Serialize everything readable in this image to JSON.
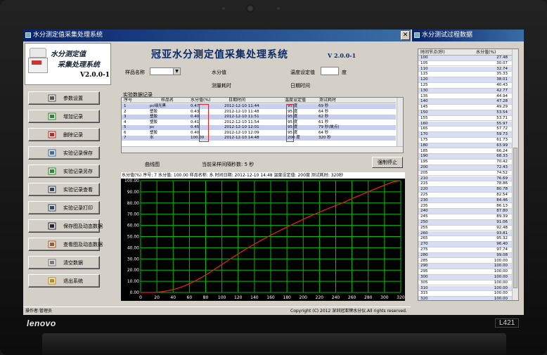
{
  "laptop": {
    "brand": "lenovo",
    "model": "L421"
  },
  "main_window": {
    "title": "水分测定值采集处理系统",
    "close_glyph": "✕"
  },
  "logo": {
    "line1": "水分测定值",
    "line2": "采集处理系统",
    "version": "V2.0.0-1"
  },
  "app": {
    "title": "冠亚水分测定值采集处理系统",
    "version": "V 2.0.0-1"
  },
  "sidebar": {
    "buttons": [
      {
        "label": "参数设置",
        "icon": "wrench-icon"
      },
      {
        "label": "增加记录",
        "icon": "add-record-icon"
      },
      {
        "label": "删除记录",
        "icon": "delete-record-icon"
      },
      {
        "label": "实验记录保存",
        "icon": "save-truck-icon"
      },
      {
        "label": "实验记录另存",
        "icon": "save-as-icon"
      },
      {
        "label": "实验记录查看",
        "icon": "magnifier-icon"
      },
      {
        "label": "实验记录打印",
        "icon": "printer-icon"
      },
      {
        "label": "保存图及动态数据",
        "icon": "floppy-icon"
      },
      {
        "label": "查看图及动态数据",
        "icon": "chart-view-icon"
      },
      {
        "label": "清空数据",
        "icon": "clear-data-icon"
      },
      {
        "label": "退出系统",
        "icon": "exit-icon"
      }
    ]
  },
  "form": {
    "sample_name_label": "样品名称",
    "sample_name_value": "",
    "moisture_label": "水分值",
    "temp_setting_label": "温度设定值",
    "temp_unit": "度",
    "measure_time_label": "测量耗时",
    "date_label": "日期时间"
  },
  "records": {
    "section_label": "实验数据记录",
    "columns": [
      "序号",
      "样品名",
      "水分值(%)",
      "日期时间",
      "温度设定值",
      "测试耗时"
    ],
    "rows": [
      {
        "no": "1",
        "name": "pc绿光黑",
        "moisture": "0.47",
        "datetime": "2012-12-10  11:44",
        "temp": "95 度",
        "time": "69 秒",
        "highlight": true
      },
      {
        "no": "2",
        "name": "塑胶",
        "moisture": "0.43",
        "datetime": "2012-12-10  11:48",
        "temp": "95 度",
        "time": "64 秒",
        "highlight": false
      },
      {
        "no": "3",
        "name": "塑胶",
        "moisture": "0.40",
        "datetime": "2012-12-10  11:51",
        "temp": "95 度",
        "time": "62 秒",
        "highlight": true
      },
      {
        "no": "4",
        "name": "塑胶",
        "moisture": "0.41",
        "datetime": "2012-12-10  11:54",
        "temp": "95 度",
        "time": "61 秒",
        "highlight": false
      },
      {
        "no": "5",
        "name": "pc",
        "moisture": "0.45",
        "datetime": "2012-12-10  12:01",
        "temp": "95 度",
        "time": "79 秒(故点)",
        "highlight": true
      },
      {
        "no": "6",
        "name": "塑胶",
        "moisture": "0.40",
        "datetime": "2012-12-10  12:09",
        "temp": "95 度",
        "time": "64 秒",
        "highlight": false
      },
      {
        "no": "7",
        "name": "水",
        "moisture": "100.00",
        "datetime": "2012-12-10  14:48",
        "temp": "200 度",
        "time": "320 秒",
        "highlight": true
      }
    ]
  },
  "chart_panel": {
    "curve_label": "曲线图",
    "interval_label": "当前采样间隔秒数: 5 秒",
    "stop_button": "强制停止",
    "header": "水分值(%) 序号: 7 水分值: 100.00 样品名称: 水 时间日期: 2012-12-10 14:48 温度设定值: 200度 测试耗时: 320秒"
  },
  "chart_data": {
    "type": "line",
    "title": "",
    "xlabel": "",
    "ylabel": "水分值(%)",
    "xlim": [
      0,
      320
    ],
    "ylim": [
      0,
      100
    ],
    "x_ticks": [
      0,
      20,
      40,
      60,
      80,
      100,
      120,
      140,
      160,
      180,
      200,
      220,
      240,
      260,
      280,
      300,
      320
    ],
    "y_ticks": [
      "0.00",
      "10.00",
      "20.00",
      "30.00",
      "40.00",
      "50.00",
      "60.00",
      "70.00",
      "80.00",
      "90.00",
      "100.00"
    ],
    "grid": true,
    "background": "#000000",
    "grid_color": "#00c000",
    "line_color": "#e02020",
    "series": [
      {
        "x": [
          0,
          5,
          10,
          15,
          20,
          25,
          30,
          35,
          40,
          45,
          50,
          55,
          60,
          65,
          70,
          75,
          80,
          85,
          90,
          95,
          100,
          110,
          120,
          130,
          140,
          150,
          160,
          170,
          180,
          190,
          200,
          210,
          220,
          230,
          240,
          250,
          260,
          270,
          280,
          290,
          300,
          310,
          320
        ],
        "y": [
          0,
          0,
          0,
          0,
          0.2,
          0.5,
          1,
          1.7,
          2.6,
          3.6,
          4.8,
          6.2,
          7.8,
          9.5,
          11.4,
          13.4,
          15.6,
          17.8,
          20.2,
          22.6,
          25.0,
          29.8,
          34.5,
          39.0,
          43.2,
          47.3,
          51.2,
          54.9,
          58.5,
          62.0,
          65.4,
          68.7,
          71.8,
          74.8,
          77.8,
          80.6,
          84.0,
          87.0,
          90.0,
          93.0,
          96.0,
          98.8,
          100.0
        ]
      }
    ]
  },
  "status": {
    "operator": "操作者:管理员",
    "copyright": "Copyright (C) 2012  深圳冠亚牌水分仪.All rights reserved."
  },
  "process_window": {
    "title": "水分测试过程数据",
    "columns": [
      "时间节点(秒)",
      "水分值(%)"
    ],
    "rows": [
      [
        "100",
        "27.48"
      ],
      [
        "105",
        "30.07"
      ],
      [
        "110",
        "32.74"
      ],
      [
        "115",
        "35.33"
      ],
      [
        "120",
        "38.01"
      ],
      [
        "125",
        "40.43"
      ],
      [
        "130",
        "42.77"
      ],
      [
        "135",
        "44.94"
      ],
      [
        "140",
        "47.28"
      ],
      [
        "145",
        "49.29"
      ],
      [
        "150",
        "53.54"
      ],
      [
        "155",
        "53.71"
      ],
      [
        "160",
        "55.97"
      ],
      [
        "165",
        "57.72"
      ],
      [
        "170",
        "59.73"
      ],
      [
        "175",
        "61.73"
      ],
      [
        "180",
        "63.99"
      ],
      [
        "185",
        "66.24"
      ],
      [
        "190",
        "68.33"
      ],
      [
        "195",
        "70.42"
      ],
      [
        "200",
        "72.43"
      ],
      [
        "205",
        "74.52"
      ],
      [
        "210",
        "76.69"
      ],
      [
        "215",
        "78.86"
      ],
      [
        "220",
        "80.78"
      ],
      [
        "225",
        "82.54"
      ],
      [
        "230",
        "84.46"
      ],
      [
        "235",
        "86.13"
      ],
      [
        "240",
        "87.80"
      ],
      [
        "245",
        "89.39"
      ],
      [
        "250",
        "91.06"
      ],
      [
        "255",
        "92.48"
      ],
      [
        "260",
        "93.81"
      ],
      [
        "265",
        "95.32"
      ],
      [
        "270",
        "96.40"
      ],
      [
        "275",
        "97.74"
      ],
      [
        "280",
        "99.08"
      ],
      [
        "285",
        "100.00"
      ],
      [
        "290",
        "100.00"
      ],
      [
        "295",
        "100.00"
      ],
      [
        "300",
        "100.00"
      ],
      [
        "305",
        "100.00"
      ],
      [
        "310",
        "100.00"
      ],
      [
        "315",
        "100.00"
      ],
      [
        "320",
        "100.00"
      ]
    ]
  }
}
